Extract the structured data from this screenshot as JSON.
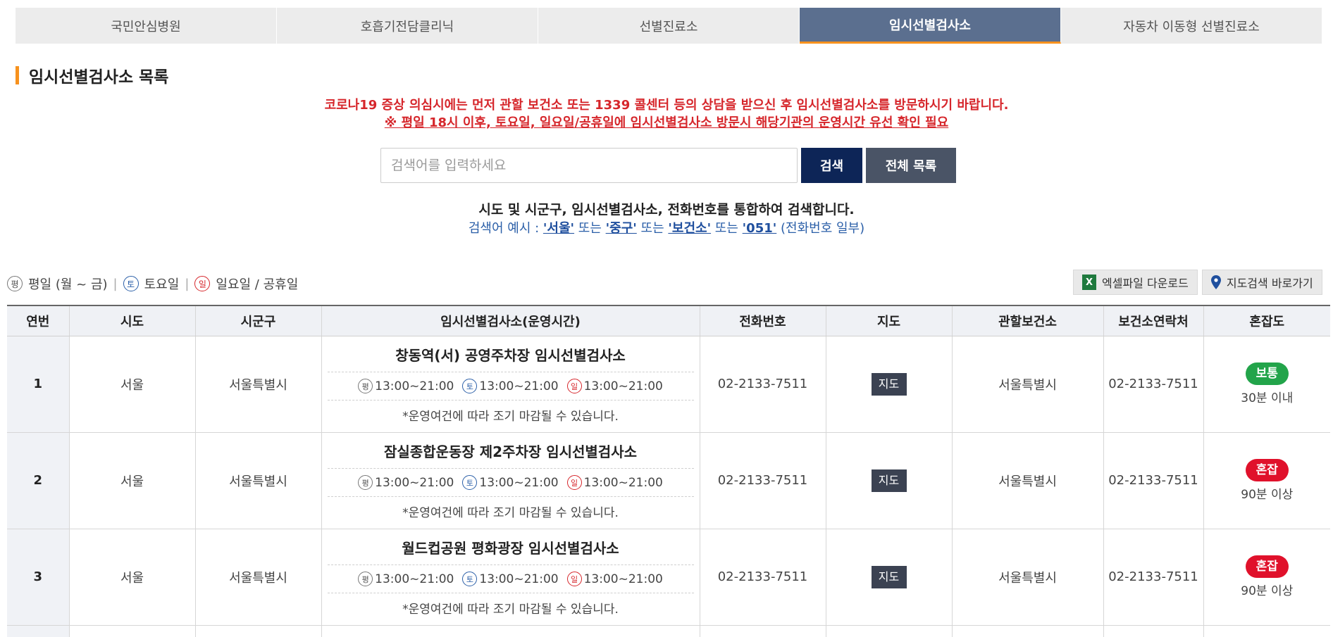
{
  "tabs": [
    {
      "label": "국민안심병원",
      "active": false
    },
    {
      "label": "호흡기전담클리닉",
      "active": false
    },
    {
      "label": "선별진료소",
      "active": false
    },
    {
      "label": "임시선별검사소",
      "active": true
    },
    {
      "label": "자동차 이동형 선별진료소",
      "active": false
    }
  ],
  "section_title": "임시선별검사소 목록",
  "notice": {
    "line1": "코로나19 증상 의심시에는 먼저 관할 보건소 또는 1339 콜센터 등의 상담을 받으신 후 임시선별검사소를 방문하시기 바랍니다.",
    "line2": "※ 평일 18시 이후, 토요일, 일요일/공휴일에 임시선별검사소 방문시 해당기관의 운영시간 유선 확인 필요"
  },
  "search": {
    "placeholder": "검색어를 입력하세요",
    "button_label": "검색",
    "all_list_label": "전체 목록"
  },
  "help": {
    "line1": "시도 및 시군구, 임시선별검사소, 전화번호를 통합하여 검색합니다.",
    "prefix": "검색어 예시 : ",
    "ex1": "'서울'",
    "or1": " 또는 ",
    "ex2": "'중구'",
    "or2": " 또는 ",
    "ex3": "'보건소'",
    "or3": " 또는 ",
    "ex4": "'051'",
    "suffix": " (전화번호 일부)"
  },
  "legend": {
    "weekday_icon": "평",
    "weekday_label": "평일 (월 ~ 금)",
    "sat_icon": "토",
    "sat_label": "토요일",
    "sun_icon": "일",
    "sun_label": "일요일 / 공휴일",
    "sep": "|"
  },
  "tools": {
    "excel_icon": "X",
    "excel_label": "엑셀파일 다운로드",
    "map_label": "지도검색 바로가기"
  },
  "table": {
    "headers": [
      "연번",
      "시도",
      "시군구",
      "임시선별검사소(운영시간)",
      "전화번호",
      "지도",
      "관할보건소",
      "보건소연락처",
      "혼잡도"
    ],
    "rows": [
      {
        "no": "1",
        "sido": "서울",
        "sigungu": "서울특별시",
        "name": "창동역(서) 공영주차장 임시선별검사소",
        "weekday": "13:00~21:00",
        "sat": "13:00~21:00",
        "sun": "13:00~21:00",
        "note": "*운영여건에 따라 조기 마감될 수 있습니다.",
        "phone": "02-2133-7511",
        "map": "지도",
        "health_center": "서울특별시",
        "hc_phone": "02-2133-7511",
        "congestion": "보통",
        "congestion_color": "#22a44a",
        "wait": "30분 이내"
      },
      {
        "no": "2",
        "sido": "서울",
        "sigungu": "서울특별시",
        "name": "잠실종합운동장 제2주차장 임시선별검사소",
        "weekday": "13:00~21:00",
        "sat": "13:00~21:00",
        "sun": "13:00~21:00",
        "note": "*운영여건에 따라 조기 마감될 수 있습니다.",
        "phone": "02-2133-7511",
        "map": "지도",
        "health_center": "서울특별시",
        "hc_phone": "02-2133-7511",
        "congestion": "혼잡",
        "congestion_color": "#e0112b",
        "wait": "90분 이상"
      },
      {
        "no": "3",
        "sido": "서울",
        "sigungu": "서울특별시",
        "name": "월드컵공원 평화광장 임시선별검사소",
        "weekday": "13:00~21:00",
        "sat": "13:00~21:00",
        "sun": "13:00~21:00",
        "note": "*운영여건에 따라 조기 마감될 수 있습니다.",
        "phone": "02-2133-7511",
        "map": "지도",
        "health_center": "서울특별시",
        "hc_phone": "02-2133-7511",
        "congestion": "혼잡",
        "congestion_color": "#e0112b",
        "wait": "90분 이상"
      }
    ]
  },
  "colors": {
    "accent_orange": "#f7921e",
    "active_tab": "#5b6f8f",
    "search_button": "#0d2557",
    "notice_red": "#d6262b"
  }
}
